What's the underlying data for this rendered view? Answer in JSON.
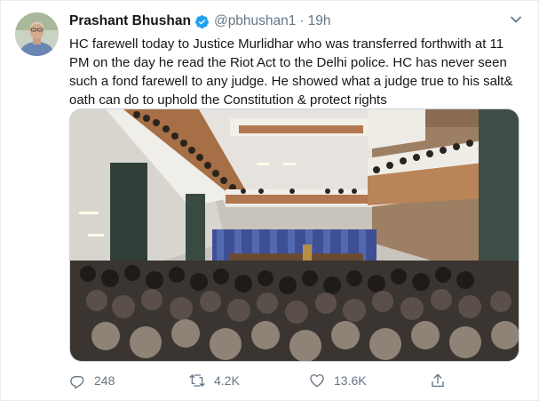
{
  "tweet": {
    "author_name": "Prashant Bhushan",
    "author_handle": "@pbhushan1",
    "separator": "·",
    "time": "19h",
    "text": "HC farewell today to Justice Murlidhar who was transferred forthwith at 11 PM on the day he read the Riot Act to the Delhi police. HC has never seen such a fond farewell to any judge. He showed what a judge true to his salt& oath can do to uphold the Constitution & protect rights"
  },
  "actions": {
    "replies": "248",
    "retweets": "4.2K",
    "likes": "13.6K"
  },
  "icons": {
    "verified": "verified-badge-icon",
    "caret": "chevron-down-icon",
    "reply": "reply-icon",
    "retweet": "retweet-icon",
    "like": "heart-icon",
    "share": "share-icon"
  },
  "colors": {
    "text": "#14171a",
    "secondary": "#657786",
    "verified": "#1da1f2",
    "border": "#e6ecf0"
  }
}
